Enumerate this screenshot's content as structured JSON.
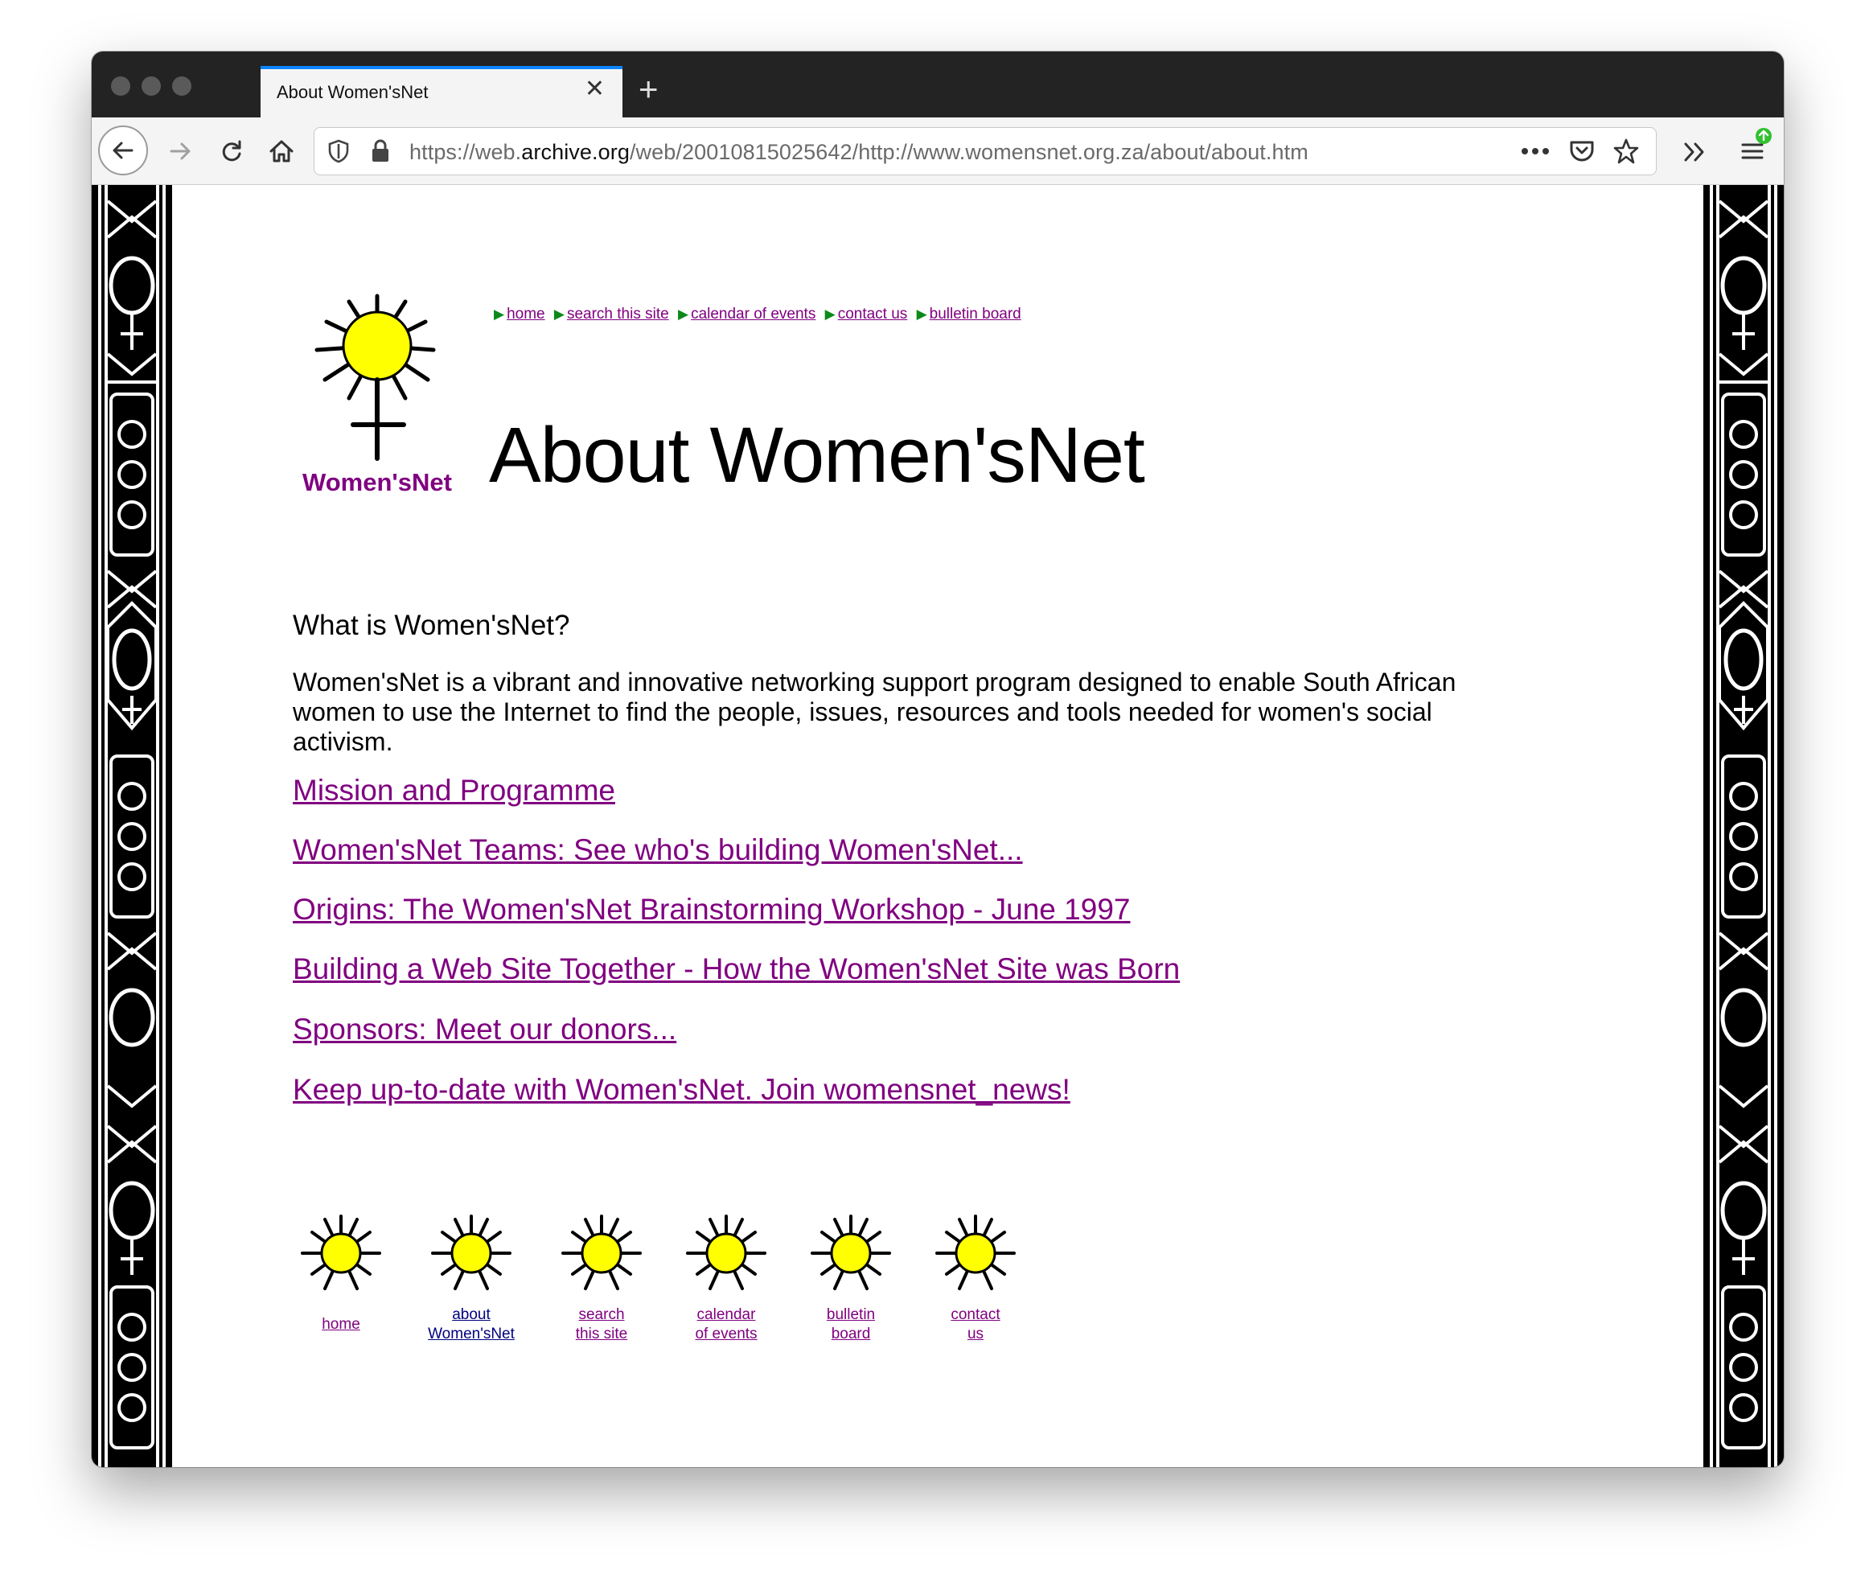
{
  "browser": {
    "tab_title": "About Women'sNet",
    "url_prefix": "https://web.",
    "url_domain": "archive.org",
    "url_path": "/web/20010815025642/http://www.womensnet.org.za/about/about.htm"
  },
  "site": {
    "logo_text": "Women'sNet",
    "top_nav": [
      "home",
      "search this site",
      "calendar of events",
      "contact us",
      "bulletin board"
    ],
    "page_title": "About Women'sNet",
    "question": "What is Women'sNet?",
    "intro": "Women'sNet is a vibrant and innovative networking support program designed to enable South African women to use the Internet to find the people, issues, resources and tools needed for women's social activism.",
    "links": [
      "Mission and Programme",
      "Women'sNet Teams: See who's building Women'sNet...",
      "Origins: The Women'sNet Brainstorming Workshop - June 1997",
      "Building a Web Site Together - How the Women'sNet Site was Born",
      "Sponsors: Meet our donors...",
      "Keep up-to-date with Women'sNet. Join womensnet_news!"
    ],
    "bottom_nav": [
      {
        "line1": "home",
        "line2": ""
      },
      {
        "line1": "about",
        "line2": "Women'sNet"
      },
      {
        "line1": "search",
        "line2": "this site"
      },
      {
        "line1": "calendar",
        "line2": "of events"
      },
      {
        "line1": "bulletin",
        "line2": "board"
      },
      {
        "line1": "contact",
        "line2": "us"
      }
    ]
  },
  "colors": {
    "link": "#800080",
    "visited_link": "#000080",
    "nav_arrow": "#0b8a1a",
    "sun_yellow": "#ffff00",
    "logo_text": "#800080",
    "tab_accent": "#0a84ff"
  }
}
